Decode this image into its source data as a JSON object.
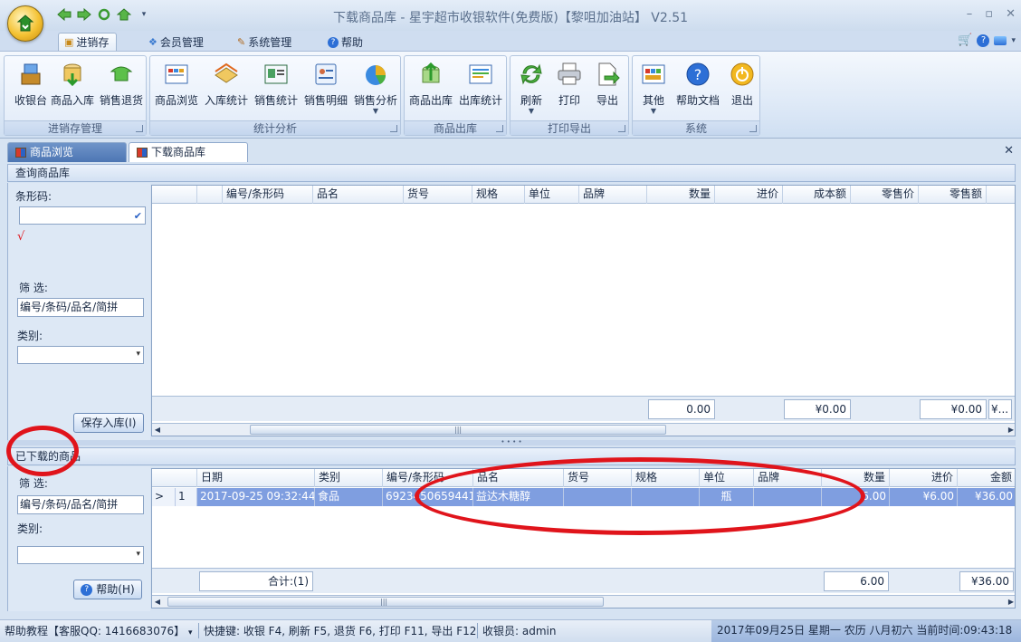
{
  "window": {
    "title": "下载商品库 - 星宇超市收银软件(免费版)【黎咀加油站】 V2.51"
  },
  "ribbon_tabs": [
    {
      "label": "进销存",
      "active": true
    },
    {
      "label": "会员管理",
      "active": false
    },
    {
      "label": "系统管理",
      "active": false
    },
    {
      "label": "帮助",
      "active": false
    }
  ],
  "ribbon_groups": [
    {
      "label": "进销存管理",
      "buttons": [
        "收银台",
        "商品入库",
        "销售退货"
      ]
    },
    {
      "label": "统计分析",
      "buttons": [
        "商品浏览",
        "入库统计",
        "销售统计",
        "销售明细",
        "销售分析"
      ]
    },
    {
      "label": "商品出库",
      "buttons": [
        "商品出库",
        "出库统计"
      ]
    },
    {
      "label": "打印导出",
      "buttons": [
        "刷新",
        "打印",
        "导出"
      ]
    },
    {
      "label": "系统",
      "buttons": [
        "其他",
        "帮助文档",
        "退出"
      ]
    }
  ],
  "doc_tabs": [
    {
      "label": "商品浏览",
      "active": false
    },
    {
      "label": "下载商品库",
      "active": true
    }
  ],
  "query_panel": {
    "header": "查询商品库",
    "barcode_label": "条形码:",
    "check_mark": "√",
    "filter_label": "筛  选:",
    "filter_value": "编号/条码/品名/简拼",
    "category_label": "类别:",
    "save_button": "保存入库(I)",
    "columns": [
      "编号/条形码",
      "品名",
      "货号",
      "规格",
      "单位",
      "品牌",
      "数量",
      "进价",
      "成本额",
      "零售价",
      "零售额"
    ],
    "totals": {
      "qty": "0.00",
      "cost": "¥0.00",
      "retail": "¥0.00",
      "more": "¥..."
    }
  },
  "downloaded_panel": {
    "header": "已下载的商品",
    "filter_label": "筛  选:",
    "filter_value": "编号/条码/品名/简拼",
    "category_label": "类别:",
    "help_button": "帮助(H)",
    "columns": [
      "日期",
      "类别",
      "编号/条形码",
      "品名",
      "货号",
      "规格",
      "单位",
      "品牌",
      "数量",
      "进价",
      "金额"
    ],
    "rows": [
      {
        "marker": ">",
        "index": "1",
        "date": "2017-09-25 09:32:44",
        "category": "食品",
        "code": "6923450659441",
        "name": "益达木糖醇",
        "sku": "",
        "spec": "",
        "unit": "瓶",
        "brand": "",
        "qty": "6.00",
        "price": "¥6.00",
        "amount": "¥36.00"
      }
    ],
    "totals": {
      "count": "合计:(1)",
      "qty": "6.00",
      "amount": "¥36.00"
    }
  },
  "statusbar": {
    "help": "帮助教程【客服QQ: 1416683076】",
    "shortcuts": "快捷键: 收银 F4, 刷新 F5, 退货 F6, 打印 F11, 导出 F12",
    "cashier": "收银员: admin",
    "datetime": "2017年09月25日 星期一  农历 八月初六  当前时间:09:43:18"
  },
  "colors": {
    "accent": "#7f9ee0",
    "annotation": "#e0141b",
    "active_tab": "#4d76b3"
  }
}
